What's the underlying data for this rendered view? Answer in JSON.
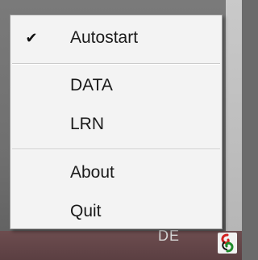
{
  "menu": {
    "items": [
      {
        "label": "Autostart",
        "checked": true,
        "check_glyph": "✔"
      },
      {
        "label": "DATA",
        "checked": false
      },
      {
        "label": "LRN",
        "checked": false
      },
      {
        "label": "About",
        "checked": false
      },
      {
        "label": "Quit",
        "checked": false
      }
    ]
  },
  "taskbar": {
    "partial_text": "DE",
    "tray_icon": "app-tray-icon"
  },
  "colors": {
    "menu_bg": "#f3f3f3",
    "menu_border": "#9a9a9a",
    "text": "#1a1a1a",
    "taskbar": "#5b3f42"
  }
}
